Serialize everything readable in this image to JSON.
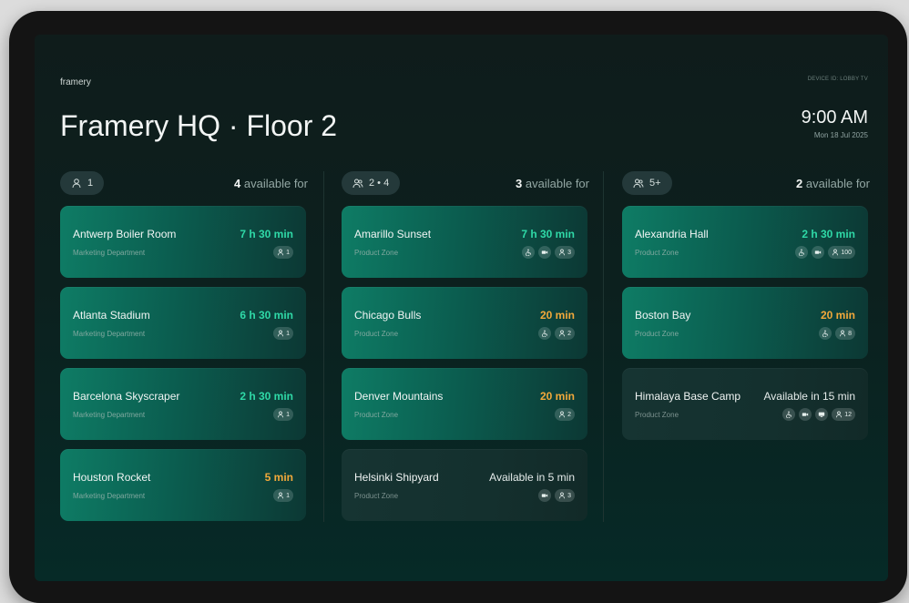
{
  "brand": "framery",
  "device_label": "DEVICE ID: LOBBY TV",
  "page_title": "Framery HQ · Floor 2",
  "clock": {
    "time": "9:00 AM",
    "date": "Mon 18 Jul 2025"
  },
  "columns": [
    {
      "capacity": "1",
      "count": "4",
      "count_suffix": " available for",
      "rooms": [
        {
          "name": "Antwerp Boiler Room",
          "zone": "Marketing Department",
          "duration": "7 h 30 min",
          "status": "green",
          "people": "1",
          "features": []
        },
        {
          "name": "Atlanta Stadium",
          "zone": "Marketing Department",
          "duration": "6 h 30 min",
          "status": "green",
          "people": "1",
          "features": []
        },
        {
          "name": "Barcelona Skyscraper",
          "zone": "Marketing Department",
          "duration": "2 h 30 min",
          "status": "green",
          "people": "1",
          "features": []
        },
        {
          "name": "Houston Rocket",
          "zone": "Marketing Department",
          "duration": "5 min",
          "status": "orange",
          "people": "1",
          "features": []
        }
      ]
    },
    {
      "capacity": "2 • 4",
      "count": "3",
      "count_suffix": " available for",
      "rooms": [
        {
          "name": "Amarillo Sunset",
          "zone": "Product Zone",
          "duration": "7 h 30 min",
          "status": "green",
          "people": "3",
          "features": [
            "accessible-icon",
            "camera-icon"
          ]
        },
        {
          "name": "Chicago Bulls",
          "zone": "Product Zone",
          "duration": "20 min",
          "status": "orange",
          "people": "2",
          "features": [
            "accessible-icon"
          ]
        },
        {
          "name": "Denver Mountains",
          "zone": "Product Zone",
          "duration": "20 min",
          "status": "orange",
          "people": "2",
          "features": []
        },
        {
          "name": "Helsinki Shipyard",
          "zone": "Product Zone",
          "duration": "Available in 5 min",
          "status": "busy",
          "people": "3",
          "features": [
            "camera-icon"
          ]
        }
      ]
    },
    {
      "capacity": "5+",
      "count": "2",
      "count_suffix": " available for",
      "rooms": [
        {
          "name": "Alexandria Hall",
          "zone": "Product Zone",
          "duration": "2 h 30 min",
          "status": "green",
          "people": "100",
          "features": [
            "accessible-icon",
            "camera-icon"
          ]
        },
        {
          "name": "Boston Bay",
          "zone": "Product Zone",
          "duration": "20 min",
          "status": "orange",
          "people": "8",
          "features": [
            "accessible-icon"
          ]
        },
        {
          "name": "Himalaya Base Camp",
          "zone": "Product Zone",
          "duration": "Available in 15 min",
          "status": "busy",
          "people": "12",
          "features": [
            "accessible-icon",
            "camera-icon",
            "screen-icon"
          ]
        }
      ]
    }
  ],
  "colors": {
    "accent_green": "#2fd9a7",
    "accent_orange": "#f2a93b",
    "card_green": "#0e7c65"
  }
}
